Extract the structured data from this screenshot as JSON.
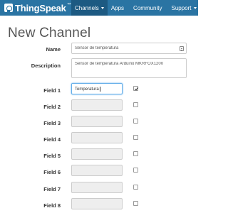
{
  "brand": {
    "name": "ThingSpeak",
    "tm": "™"
  },
  "nav": {
    "items": [
      {
        "label": "Channels",
        "active": true,
        "dropdown": true
      },
      {
        "label": "Apps",
        "active": false,
        "dropdown": false
      },
      {
        "label": "Community",
        "active": false,
        "dropdown": false
      },
      {
        "label": "Support",
        "active": false,
        "dropdown": true
      }
    ]
  },
  "page": {
    "title": "New Channel"
  },
  "form": {
    "name": {
      "label": "Name",
      "value": "Sensor de temperatura"
    },
    "description": {
      "label": "Description",
      "value": "Sensor de temperatura Arduino MKRFOX1200"
    },
    "fields": [
      {
        "label": "Field 1",
        "value": "Temperatura",
        "enabled": true
      },
      {
        "label": "Field 2",
        "value": "",
        "enabled": false
      },
      {
        "label": "Field 3",
        "value": "",
        "enabled": false
      },
      {
        "label": "Field 4",
        "value": "",
        "enabled": false
      },
      {
        "label": "Field 5",
        "value": "",
        "enabled": false
      },
      {
        "label": "Field 6",
        "value": "",
        "enabled": false
      },
      {
        "label": "Field 7",
        "value": "",
        "enabled": false
      },
      {
        "label": "Field 8",
        "value": "",
        "enabled": false
      }
    ]
  },
  "colors": {
    "navbar": "#2a74a3",
    "nav_active": "#1d5a82",
    "disabled_input": "#eeeeee"
  }
}
